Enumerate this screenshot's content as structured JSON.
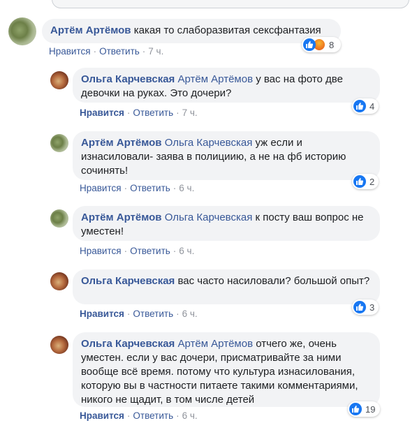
{
  "actions": {
    "like": "Нравится",
    "reply": "Ответить",
    "separator": "·"
  },
  "comments": [
    {
      "author": "Артём Артёмов",
      "mention": "",
      "text": "какая то слаборазвитая сексфантазия",
      "time": "7 ч.",
      "reactions": {
        "icons": [
          "like-icon",
          "angry-icon"
        ],
        "count": "8"
      },
      "liked": false
    },
    {
      "author": "Ольга Карчевская",
      "mention": "Артём Артёмов",
      "text": "у вас на фото две девочки на руках. Это дочери?",
      "time": "7 ч.",
      "reactions": {
        "icons": [
          "like-icon"
        ],
        "count": "4"
      },
      "liked": true
    },
    {
      "author": "Артём Артёмов",
      "mention": "Ольга Карчевская",
      "text": "уж если и изнасиловали- заява в полициию, а не на фб историю сочинять!",
      "time": "6 ч.",
      "reactions": {
        "icons": [
          "like-icon"
        ],
        "count": "2"
      },
      "liked": false
    },
    {
      "author": "Артём Артёмов",
      "mention": "Ольга Карчевская",
      "text": "к посту ваш вопрос не уместен!",
      "time": "6 ч.",
      "reactions": null,
      "liked": false
    },
    {
      "author": "Ольга Карчевская",
      "mention": "",
      "text": "вас часто насиловали? большой опыт?",
      "time": "6 ч.",
      "reactions": {
        "icons": [
          "like-icon"
        ],
        "count": "3"
      },
      "liked": true
    },
    {
      "author": "Ольга Карчевская",
      "mention": "Артём Артёмов",
      "text": "отчего же, очень уместен. если у вас дочери, присматривайте за ними вообще всё время. потому что культура изнасилования, которую вы в частности питаете такими комментариями, никого не щадит, в том числе детей",
      "time": "6 ч.",
      "reactions": {
        "icons": [
          "like-icon"
        ],
        "count": "19"
      },
      "liked": true
    }
  ],
  "colors": {
    "link": "#385898",
    "bubble": "#f2f3f5",
    "meta": "#90949c",
    "like": "#1877f2"
  }
}
